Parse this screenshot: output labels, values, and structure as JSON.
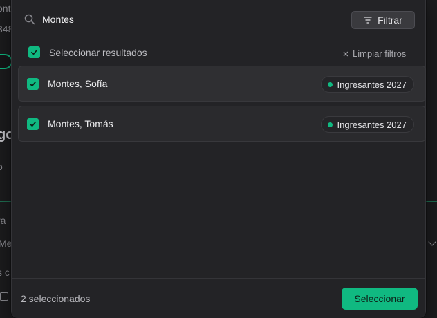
{
  "background": {
    "fragments": [
      "ont",
      "348",
      "go",
      "o",
      "ra",
      "Me",
      "s c"
    ]
  },
  "search": {
    "value": "Montes",
    "placeholder": "",
    "filter_label": "Filtrar"
  },
  "selection": {
    "select_all_label": "Seleccionar resultados",
    "clear_filters_label": "Limpiar filtros"
  },
  "results": [
    {
      "name": "Montes, Sofía",
      "tag": "Ingresantes 2027",
      "checked": true
    },
    {
      "name": "Montes, Tomás",
      "tag": "Ingresantes 2027",
      "checked": true
    }
  ],
  "footer": {
    "count_label": "2 seleccionados",
    "select_button_label": "Seleccionar"
  },
  "colors": {
    "accent": "#10b981",
    "modal_bg": "#232326",
    "row_bg": "#2a2a2d"
  }
}
